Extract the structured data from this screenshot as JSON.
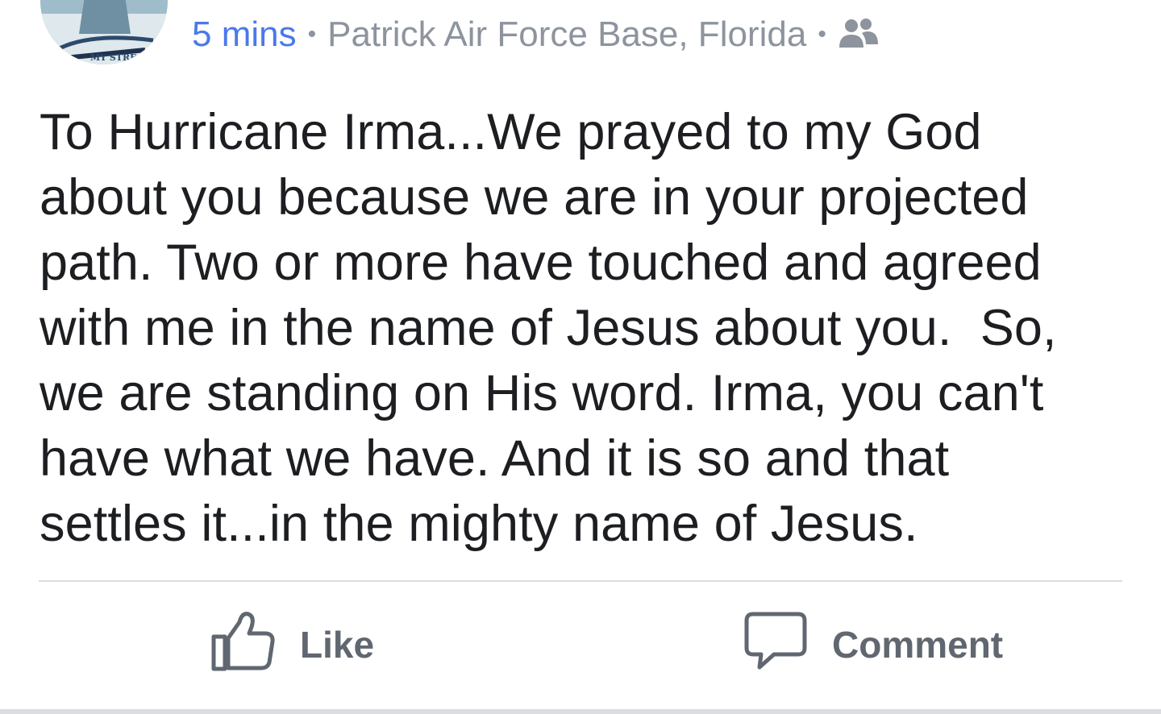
{
  "post": {
    "avatar_icon": "profile-photo",
    "time": "5 mins",
    "separator": "•",
    "location": "Patrick Air Force Base, Florida",
    "audience_icon": "friends-icon",
    "text_lines": [
      "To Hurricane Irma...We prayed to my God",
      "about you because we are in your projected",
      "path. Two or more have touched and agreed",
      "with me in the name of Jesus about you.  So,",
      "we are standing on His word. Irma, you can't",
      "have what we have. And it is so and that",
      "settles it...in the mighty name of Jesus."
    ]
  },
  "actions": {
    "like_label": "Like",
    "like_icon": "thumbs-up-icon",
    "comment_label": "Comment",
    "comment_icon": "speech-bubble-icon"
  },
  "colors": {
    "link_blue": "#4b79ea",
    "meta_gray": "#8d949e",
    "text": "#1c1e21",
    "action_gray": "#606770",
    "divider": "#dadde1"
  }
}
